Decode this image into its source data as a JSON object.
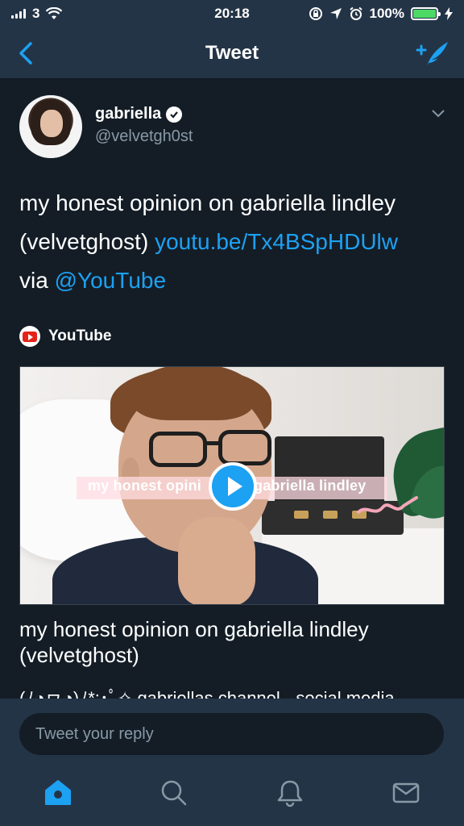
{
  "status_bar": {
    "carrier": "3",
    "time": "20:18",
    "battery": "100%",
    "icons": [
      "signal-icon",
      "wifi-icon",
      "lock-rotation-icon",
      "location-icon",
      "alarm-icon",
      "battery-icon",
      "charging-icon"
    ]
  },
  "nav": {
    "title": "Tweet",
    "back_icon": "back-chevron-icon",
    "compose_icon": "compose-tweet-icon"
  },
  "tweet": {
    "display_name": "gabriella",
    "handle": "@velvetgh0st",
    "verified": true,
    "text_line1": "my honest opinion on gabriella lindley",
    "text_line2_prefix": "(velvetghost) ",
    "link": "youtu.be/Tx4BSpHDUlw",
    "text_line3_prefix": "via ",
    "mention": "@YouTube"
  },
  "card": {
    "source": "YouTube",
    "thumbnail_caption_left": "my honest opini",
    "thumbnail_caption_right": "gabriella lindley",
    "title": "my honest opinion on gabriella lindley (velvetghost)",
    "description": "(ﾉ◕ヮ◕)ﾉ*:･ﾟ✧ gabriellas channel - social media"
  },
  "reply": {
    "placeholder": "Tweet your reply"
  },
  "tabs": [
    {
      "name": "home",
      "icon": "home-icon",
      "active": true
    },
    {
      "name": "search",
      "icon": "search-icon",
      "active": false
    },
    {
      "name": "notifications",
      "icon": "bell-icon",
      "active": false
    },
    {
      "name": "messages",
      "icon": "mail-icon",
      "active": false
    }
  ],
  "colors": {
    "accent": "#1da1f2",
    "background": "#141d26",
    "bar": "#243447",
    "secondary_text": "#8899a6"
  }
}
